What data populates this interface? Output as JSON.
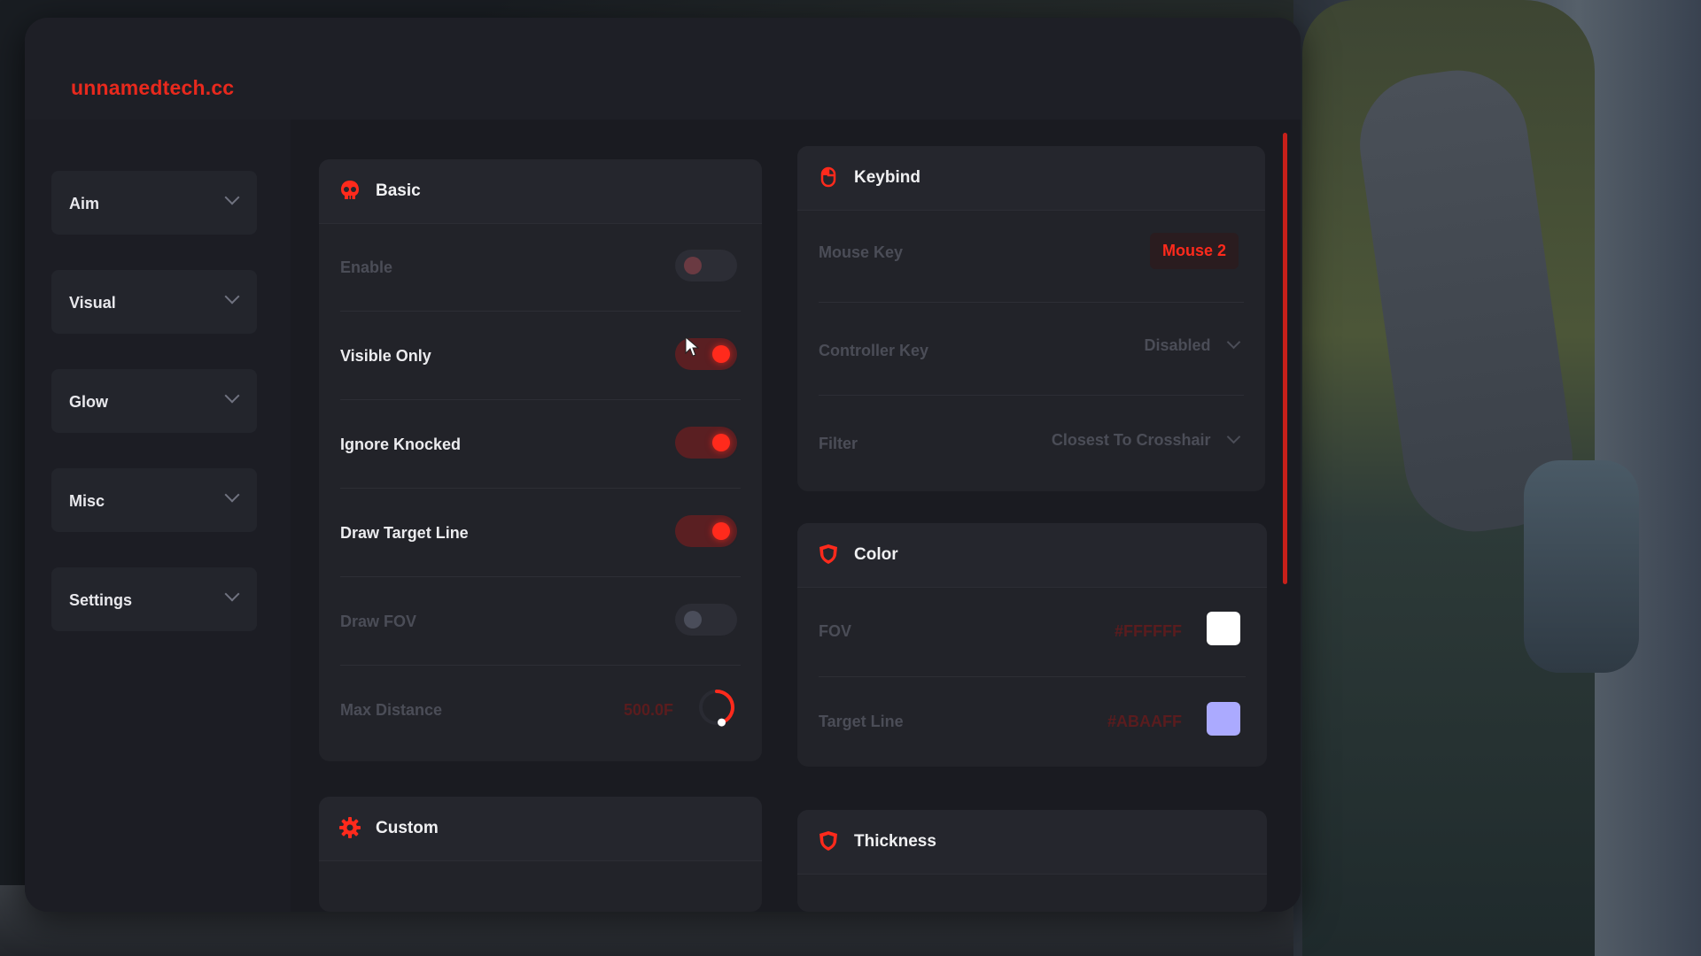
{
  "app": {
    "brand": "unnamedtech.cc"
  },
  "sidebar": {
    "items": [
      {
        "label": "Aim"
      },
      {
        "label": "Visual"
      },
      {
        "label": "Glow"
      },
      {
        "label": "Misc"
      },
      {
        "label": "Settings"
      }
    ]
  },
  "basic": {
    "title": "Basic",
    "icon": "skull-icon",
    "rows": [
      {
        "label": "Enable",
        "state": "off"
      },
      {
        "label": "Visible Only",
        "state": "on"
      },
      {
        "label": "Ignore Knocked",
        "state": "on"
      },
      {
        "label": "Draw Target Line",
        "state": "on"
      },
      {
        "label": "Draw FOV",
        "state": "off"
      }
    ],
    "max_distance": {
      "label": "Max Distance",
      "value": "500.0F",
      "fraction": 0.45
    }
  },
  "keybind": {
    "title": "Keybind",
    "icon": "mouse-icon",
    "mouse_key": {
      "label": "Mouse Key",
      "value": "Mouse 2"
    },
    "controller_key": {
      "label": "Controller Key",
      "value": "Disabled"
    },
    "filter": {
      "label": "Filter",
      "value": "Closest To Crosshair"
    }
  },
  "color": {
    "title": "Color",
    "icon": "shield-icon",
    "fov": {
      "label": "FOV",
      "hex": "#FFFFFF",
      "swatch": "#ffffff"
    },
    "target_line": {
      "label": "Target Line",
      "hex": "#ABAAFF",
      "swatch": "#abaaff"
    }
  },
  "custom": {
    "title": "Custom",
    "icon": "gear-icon"
  },
  "thickness": {
    "title": "Thickness",
    "icon": "shield-icon"
  },
  "colors": {
    "accent": "#ff2a1c"
  }
}
